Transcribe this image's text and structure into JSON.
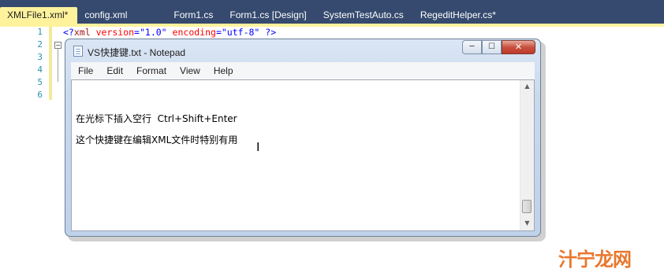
{
  "tabs": [
    {
      "label": "XMLFile1.xml*",
      "active": true
    },
    {
      "label": "config.xml",
      "active": false
    },
    {
      "label": "Form1.cs",
      "active": false
    },
    {
      "label": "Form1.cs [Design]",
      "active": false
    },
    {
      "label": "SystemTestAuto.cs",
      "active": false
    },
    {
      "label": "RegeditHelper.cs*",
      "active": false
    }
  ],
  "editor": {
    "line_numbers": [
      "1",
      "2",
      "3",
      "4",
      "5",
      "6"
    ],
    "line1": {
      "open": "<?",
      "name": "xml",
      "attr1": "version",
      "eq1": "=",
      "val1": "\"1.0\"",
      "attr2": "encoding",
      "eq2": "=",
      "val2": "\"utf-8\"",
      "close": "?>"
    },
    "outline_glyph": "−"
  },
  "notepad": {
    "title": "VS快捷键.txt - Notepad",
    "menu": [
      "File",
      "Edit",
      "Format",
      "View",
      "Help"
    ],
    "text_lines": [
      {
        "prefix": "在光标下插入空行",
        "shortcut": "  Ctrl+Shift+Enter"
      },
      {
        "prefix": "这个快捷键在编辑XML文件时特别有用",
        "shortcut": ""
      }
    ],
    "caption_buttons": {
      "minimize": "─",
      "maximize": "☐",
      "close": "✕"
    }
  },
  "watermark": {
    "text": "汁宁龙网"
  },
  "colors": {
    "vs_background": "#293955",
    "active_tab": "#fff29d",
    "watermark": "#e8772e"
  }
}
